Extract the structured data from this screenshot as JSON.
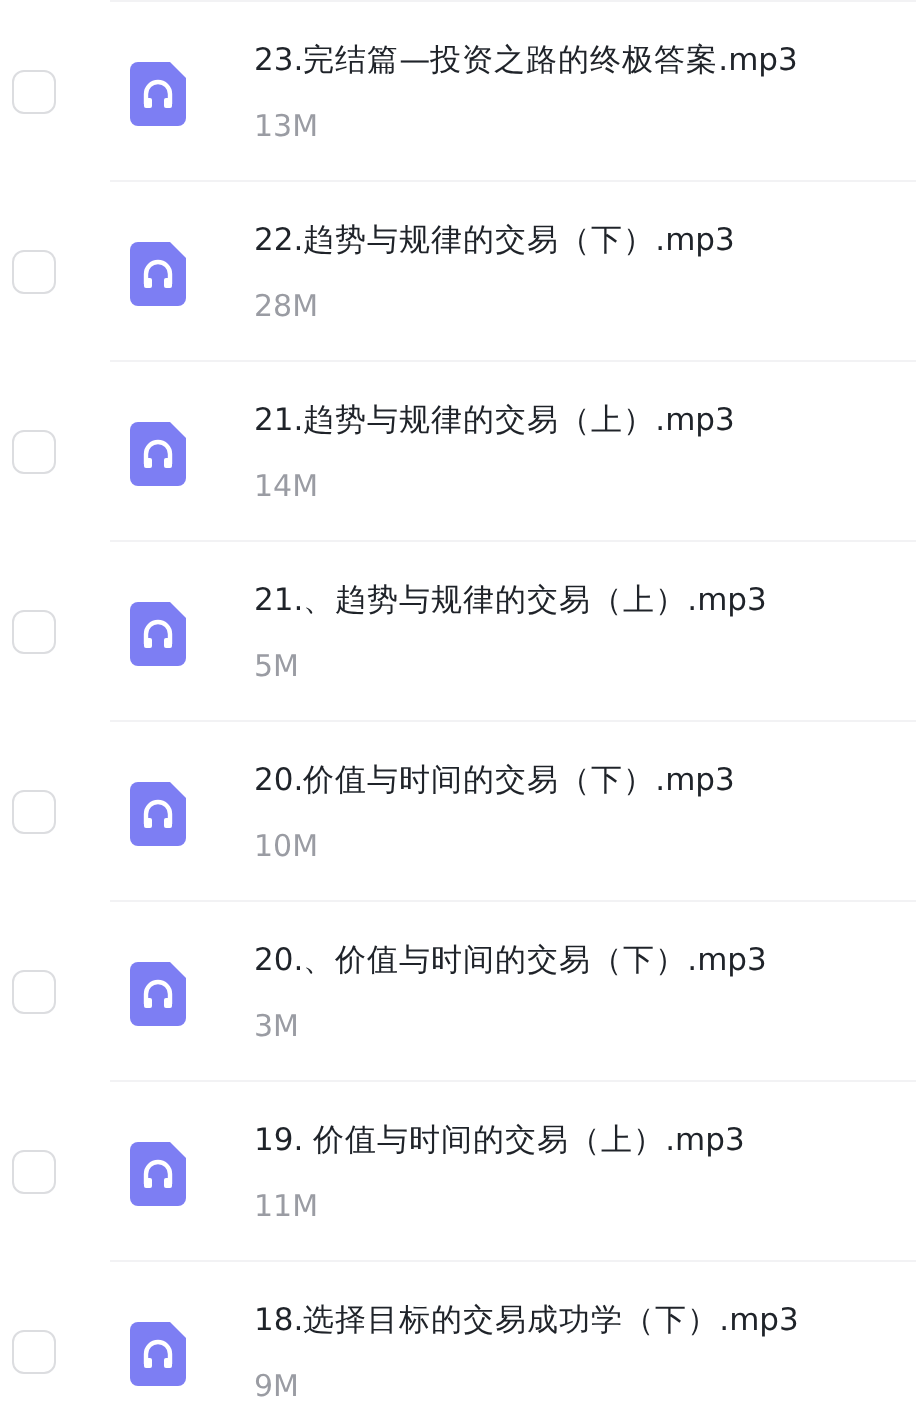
{
  "files": [
    {
      "name": "23.完结篇—投资之路的终极答案.mp3",
      "size": "13M",
      "checked": false
    },
    {
      "name": "22.趋势与规律的交易（下）.mp3",
      "size": "28M",
      "checked": false
    },
    {
      "name": "21.趋势与规律的交易（上）.mp3",
      "size": "14M",
      "checked": false
    },
    {
      "name": "21.、趋势与规律的交易（上）.mp3",
      "size": "5M",
      "checked": false
    },
    {
      "name": "20.价值与时间的交易（下）.mp3",
      "size": "10M",
      "checked": false
    },
    {
      "name": "20.、价值与时间的交易（下）.mp3",
      "size": "3M",
      "checked": false
    },
    {
      "name": "19. 价值与时间的交易（上）.mp3",
      "size": "11M",
      "checked": false
    },
    {
      "name": "18.选择目标的交易成功学（下）.mp3",
      "size": "9M",
      "checked": false
    }
  ]
}
